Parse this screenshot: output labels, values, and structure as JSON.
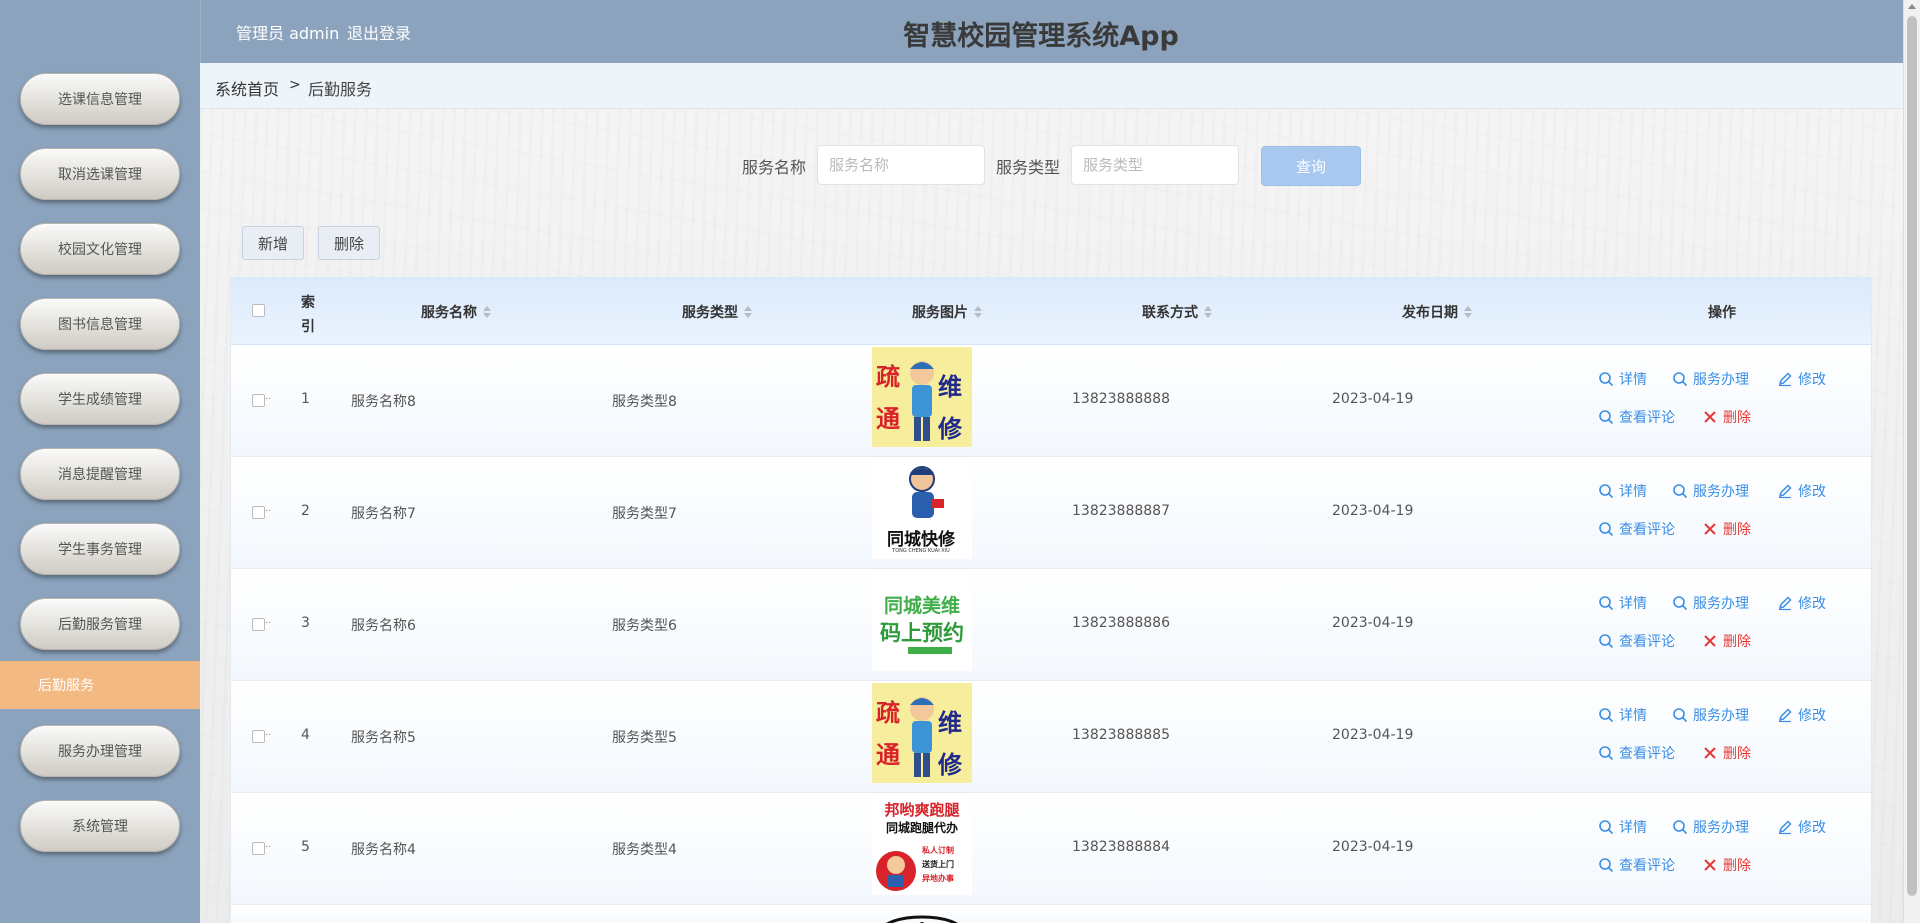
{
  "header": {
    "user_label": "管理员 admin",
    "logout_label": "退出登录",
    "app_title": "智慧校园管理系统App"
  },
  "sidebar": {
    "items": [
      {
        "label": "选课信息管理"
      },
      {
        "label": "取消选课管理"
      },
      {
        "label": "校园文化管理"
      },
      {
        "label": "图书信息管理"
      },
      {
        "label": "学生成绩管理"
      },
      {
        "label": "消息提醒管理"
      },
      {
        "label": "学生事务管理"
      },
      {
        "label": "后勤服务管理"
      },
      {
        "label": "服务办理管理"
      },
      {
        "label": "系统管理"
      }
    ],
    "active_sub": "后勤服务"
  },
  "breadcrumb": {
    "home": "系统首页",
    "separator": ">",
    "current": "后勤服务"
  },
  "search": {
    "name_label": "服务名称",
    "name_placeholder": "服务名称",
    "type_label": "服务类型",
    "type_placeholder": "服务类型",
    "query_label": "查询"
  },
  "toolbar": {
    "add_label": "新增",
    "delete_label": "删除"
  },
  "table": {
    "columns": {
      "index": "索引",
      "name": "服务名称",
      "type": "服务类型",
      "image": "服务图片",
      "contact": "联系方式",
      "date": "发布日期",
      "actions": "操作"
    },
    "actions": {
      "detail": "详情",
      "handle": "服务办理",
      "edit": "修改",
      "comments": "查看评论",
      "delete": "删除"
    },
    "rows": [
      {
        "index": "1",
        "name": "服务名称8",
        "type": "服务类型8",
        "phone": "13823888888",
        "date": "2023-04-19",
        "image": "poster-repair-cartoon"
      },
      {
        "index": "2",
        "name": "服务名称7",
        "type": "服务类型7",
        "phone": "13823888887",
        "date": "2023-04-19",
        "image": "tongcheng-kuaixiu-logo",
        "image_text": "同城快修",
        "image_sub": "TONG CHENG KUAI XIU"
      },
      {
        "index": "3",
        "name": "服务名称6",
        "type": "服务类型6",
        "phone": "13823888886",
        "date": "2023-04-19",
        "image": "green-poster",
        "image_text1": "同城美维",
        "image_text2": "码上预约"
      },
      {
        "index": "4",
        "name": "服务名称5",
        "type": "服务类型5",
        "phone": "13823888885",
        "date": "2023-04-19",
        "image": "poster-repair-cartoon"
      },
      {
        "index": "5",
        "name": "服务名称4",
        "type": "服务类型4",
        "phone": "13823888884",
        "date": "2023-04-19",
        "image": "errand-poster",
        "image_text1": "邦哟爽跑腿",
        "image_text2": "同城跑腿代办",
        "image_tags": [
          "私人订制",
          "送货上门",
          "异地办事"
        ]
      }
    ]
  },
  "colors": {
    "sidebar_bg": "#8ba3bd",
    "active_menu": "#f3b983",
    "link_blue": "#3a8ee6",
    "delete_red": "#e53935",
    "query_button": "#a8c8ef"
  }
}
